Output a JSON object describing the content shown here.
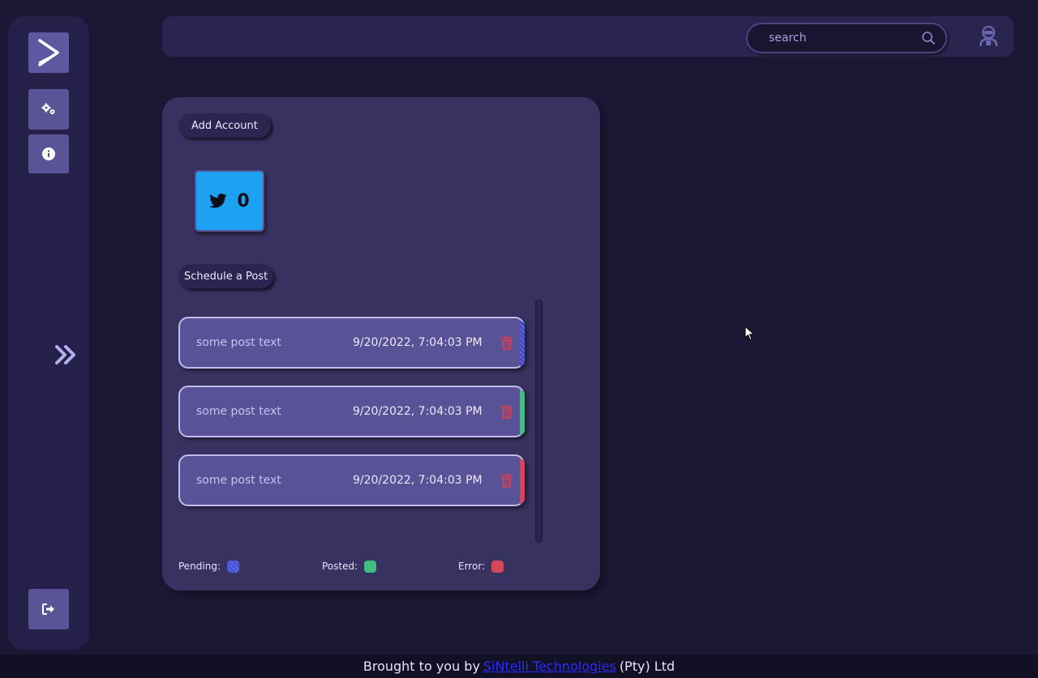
{
  "sidebar": {
    "logo_icon": "chevron-right-logo-icon",
    "items": [
      {
        "icon": "gears-icon"
      },
      {
        "icon": "info-icon"
      }
    ],
    "expand_icon": "double-chevron-right-icon",
    "logout_icon": "logout-icon"
  },
  "header": {
    "search": {
      "placeholder": "search",
      "icon": "search-icon"
    },
    "avatar_icon": "user-avatar-icon"
  },
  "main": {
    "add_account_label": "Add Account",
    "accounts": [
      {
        "platform_icon": "twitter-icon",
        "count": "0",
        "color": "#1da1f2"
      }
    ],
    "schedule_label": "Schedule a Post",
    "posts": [
      {
        "text": "some post text",
        "time": "9/20/2022, 7:04:03 PM",
        "status": "pending",
        "status_color": "#5b64e8"
      },
      {
        "text": "some post text",
        "time": "9/20/2022, 7:04:03 PM",
        "status": "posted",
        "status_color": "#3fbf7f"
      },
      {
        "text": "some post text",
        "time": "9/20/2022, 7:04:03 PM",
        "status": "error",
        "status_color": "#d7455b"
      }
    ],
    "legend": [
      {
        "label": "Pending:",
        "color": "#5b64e8"
      },
      {
        "label": "Posted:",
        "color": "#3fbf7f"
      },
      {
        "label": "Error:",
        "color": "#d7455b"
      }
    ]
  },
  "footer": {
    "prefix": "Brought to you by",
    "link_text": "SiNtelli Technologies",
    "suffix": "(Pty) Ltd"
  },
  "colors": {
    "background": "#1b1836",
    "panel": "#37325f",
    "accent": "#5a5396",
    "delete": "#d7455b"
  }
}
